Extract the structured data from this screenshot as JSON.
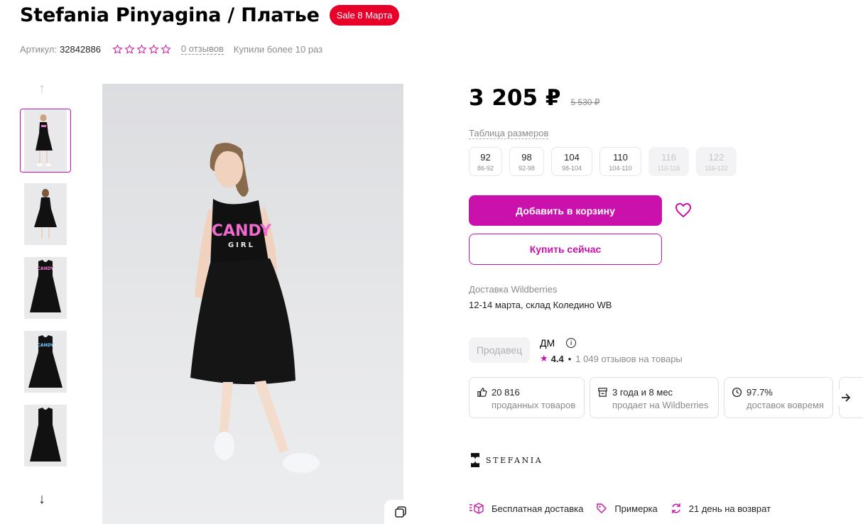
{
  "product": {
    "title": "Stefania Pinyagina / Платье",
    "badge": "Sale 8 Марта",
    "article_label": "Артикул:",
    "article": "32842886",
    "reviews": "0 отзывов",
    "bought": "Купили более 10 раз",
    "rating_stars": 5
  },
  "gallery": {
    "up_icon": "arrow-up-icon",
    "down_icon": "arrow-down-icon",
    "thumbs": [
      "thumb-1",
      "thumb-2",
      "thumb-3",
      "thumb-4",
      "thumb-5"
    ],
    "main_print_line1": "CANDY",
    "main_print_line2": "GIRL"
  },
  "price": {
    "current": "3 205 ₽",
    "old": "5 530 ₽"
  },
  "sizes": {
    "table_label": "Таблица размеров",
    "items": [
      {
        "n": "92",
        "r": "86-92",
        "available": true
      },
      {
        "n": "98",
        "r": "92-98",
        "available": true
      },
      {
        "n": "104",
        "r": "98-104",
        "available": true
      },
      {
        "n": "110",
        "r": "104-110",
        "available": true
      },
      {
        "n": "116",
        "r": "110-116",
        "available": false
      },
      {
        "n": "122",
        "r": "116-122",
        "available": false
      }
    ]
  },
  "actions": {
    "add_to_cart": "Добавить в корзину",
    "buy_now": "Купить сейчас"
  },
  "delivery": {
    "label": "Доставка Wildberries",
    "value": "12-14 марта, склад Коледино WB"
  },
  "seller": {
    "tag": "Продавец",
    "name": "ДМ",
    "rating": "4.4",
    "reviews": "1 049 отзывов на товары"
  },
  "stats": [
    {
      "icon": "thumbs-up-icon",
      "value": "20 816",
      "label": "проданных товаров"
    },
    {
      "icon": "store-icon",
      "value": "3 года и 8 мес",
      "label": "продает на Wildberries"
    },
    {
      "icon": "clock-icon",
      "value": "97.7%",
      "label": "доставок вовремя"
    }
  ],
  "brand": {
    "logo_text": "STEFANIA"
  },
  "features": [
    {
      "icon": "delivery-icon",
      "label": "Бесплатная доставка"
    },
    {
      "icon": "tag-icon",
      "label": "Примерка"
    },
    {
      "icon": "return-icon",
      "label": "21 день на возврат"
    }
  ],
  "colors": {
    "accent": "#cb11ab",
    "sale": "#e8002a",
    "muted": "#8b8b8b"
  }
}
